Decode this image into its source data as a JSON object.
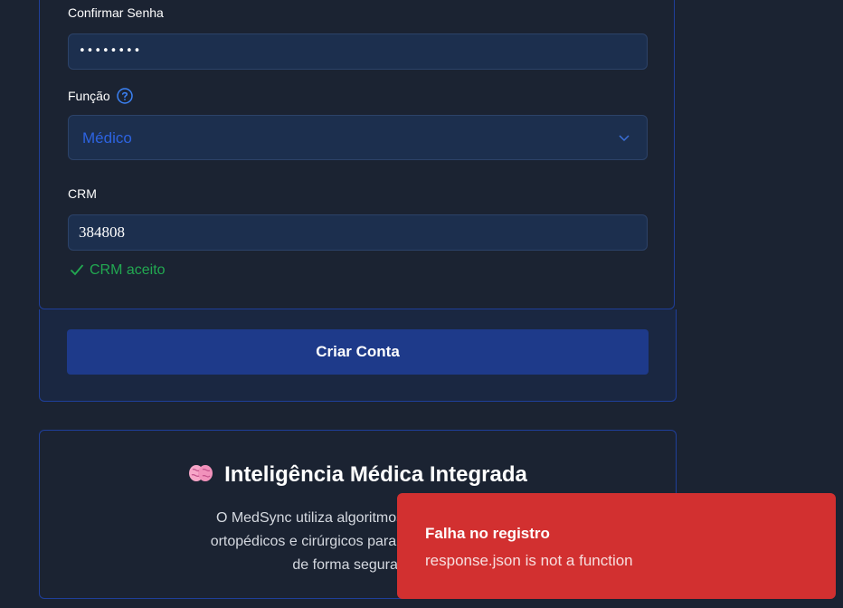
{
  "form": {
    "confirm_password_label": "Confirmar Senha",
    "confirm_password_value": "••••••••",
    "function_label": "Função",
    "function_value": "Médico",
    "crm_label": "CRM",
    "crm_value": "384808",
    "crm_status": "CRM aceito",
    "submit_label": "Criar Conta"
  },
  "info": {
    "title": "Inteligência Médica Integrada",
    "lines": [
      "O MedSync utiliza algoritmos treinados com",
      "ortopédicos e cirúrgicos para sugerir os proce",
      "de forma segura e e"
    ]
  },
  "toast": {
    "title": "Falha no registro",
    "message": "response.json is not a function"
  },
  "colors": {
    "background": "#1b2332",
    "accent_border": "#1f3f9a",
    "button": "#1e3a8a",
    "success": "#22a851",
    "error": "#d23030"
  },
  "icons": [
    "help-circle-icon",
    "chevron-down-icon",
    "check-icon",
    "brain-icon"
  ]
}
